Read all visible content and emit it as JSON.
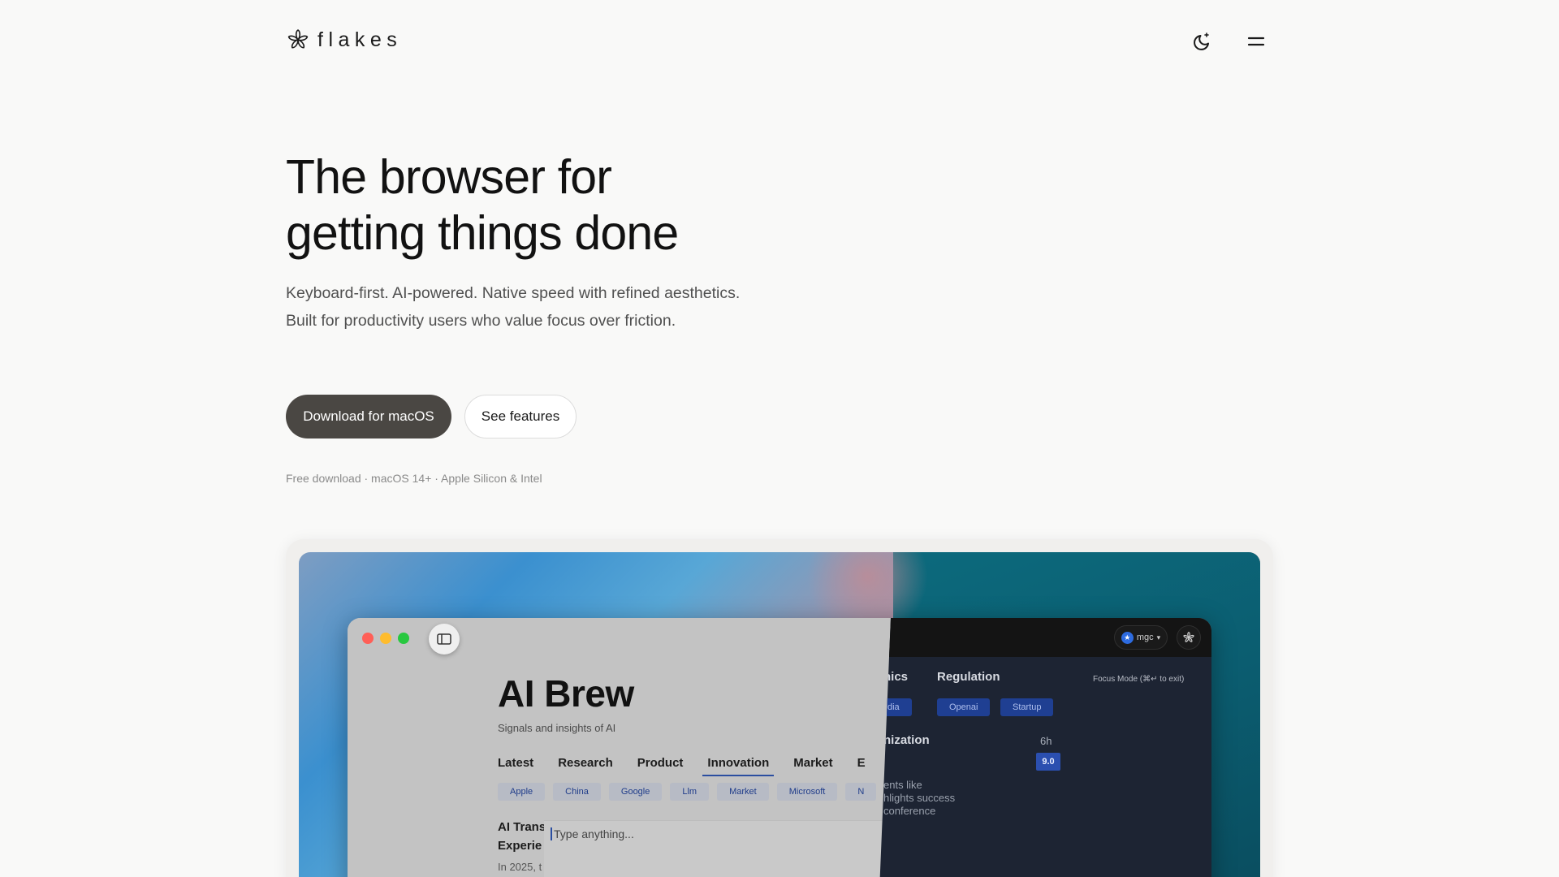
{
  "header": {
    "logo_text": "flakes",
    "theme_toggle_icon": "moon-sparkle-icon",
    "menu_icon": "menu-icon"
  },
  "hero": {
    "title_line1": "The browser for",
    "title_line2": "getting things done",
    "subtitle": "Keyboard-first. AI-powered. Native speed with refined aesthetics. Built for productivity users who value focus over friction.",
    "primary_cta": "Download for macOS",
    "secondary_cta": "See features",
    "fine_print": "Free download · macOS 14+ · Apple Silicon & Intel"
  },
  "preview": {
    "light": {
      "site_title": "AI Brew",
      "site_subtitle": "Signals and insights of AI",
      "tabs": [
        "Latest",
        "Research",
        "Product",
        "Innovation",
        "Market",
        "E"
      ],
      "active_tab": "Innovation",
      "chips": [
        "Apple",
        "China",
        "Google",
        "Llm",
        "Market",
        "Microsoft",
        "N"
      ],
      "article_title_line1": "AI Trans",
      "article_title_line2": "Experie",
      "article_snippet": "In 2025, t",
      "command_placeholder": "Type anything..."
    },
    "dark": {
      "tab_partial": "hics",
      "tab_regulation": "Regulation",
      "focus_hint": "Focus Mode (⌘↵ to exit)",
      "chips": [
        "dia",
        "Openai",
        "Startup"
      ],
      "heading_partial": "nization",
      "time": "6h",
      "score": "9.0",
      "lines": [
        "ents like",
        "hlights success",
        "conference"
      ],
      "account_label": "mgc"
    }
  },
  "colors": {
    "primary_button": "#4a4743",
    "accent_blue": "#2b4ea0",
    "traffic_red": "#ff5f57",
    "traffic_yellow": "#febc2e",
    "traffic_green": "#28c840"
  }
}
